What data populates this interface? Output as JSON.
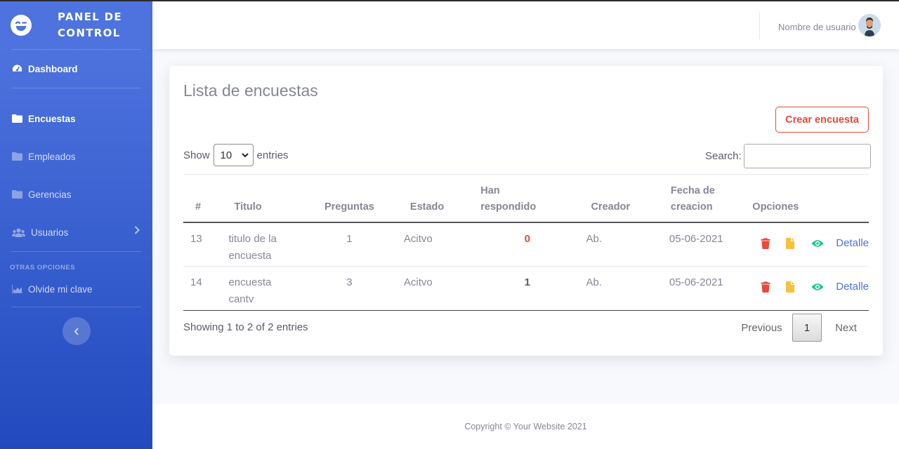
{
  "brand": {
    "name": "PANEL DE CONTROL",
    "line1": "PANEL DE",
    "line2": "CONTROL",
    "icon": "laugh-wink-icon"
  },
  "sidebar": {
    "dashboard": "Dashboard",
    "items": [
      {
        "label": "Encuestas",
        "icon": "folder-icon",
        "active": true
      },
      {
        "label": "Empleados",
        "icon": "folder-icon"
      },
      {
        "label": "Gerencias",
        "icon": "folder-icon"
      },
      {
        "label": "Usuarios",
        "icon": "users-icon",
        "has_submenu": true
      }
    ],
    "heading_other": "OTRAS OPCIONES",
    "olvide": "Olvide mi clave"
  },
  "topbar": {
    "user_name": "Nombre de usuario"
  },
  "card": {
    "title": "Lista de encuestas",
    "create_button": "Crear encuesta",
    "length": {
      "before": "Show",
      "value": "10",
      "after": "entries"
    },
    "search_label": "Search:",
    "search_value": "",
    "columns": [
      "#",
      "Titulo",
      "Preguntas",
      "Estado",
      "Han respondido",
      "Creador",
      "Fecha de creacion",
      "Opciones"
    ],
    "columns_split": {
      "han_1": "Han",
      "han_2": "respondido",
      "fecha_1": "Fecha de",
      "fecha_2": "creacion"
    },
    "rows": [
      {
        "num": "13",
        "titulo_1": "titulo de la",
        "titulo_2": "encuesta",
        "preguntas": "1",
        "estado": "Acitvo",
        "han_respondido": "0",
        "creador": "Ab.",
        "fecha": "05-06-2021",
        "detalle": "Detalle"
      },
      {
        "num": "14",
        "titulo_1": "encuesta",
        "titulo_2": "cantv",
        "preguntas": "3",
        "estado": "Acitvo",
        "han_respondido": "1",
        "creador": "Ab.",
        "fecha": "05-06-2021",
        "detalle": "Detalle"
      }
    ],
    "info": "Showing 1 to 2 of 2 entries",
    "pager": {
      "previous": "Previous",
      "current": "1",
      "next": "Next"
    }
  },
  "footer": {
    "text": "Copyright © Your Website 2021"
  },
  "colors": {
    "primary": "#4e73df",
    "danger": "#e74a3b",
    "warning": "#f6c23e",
    "success": "#1cc88a"
  }
}
